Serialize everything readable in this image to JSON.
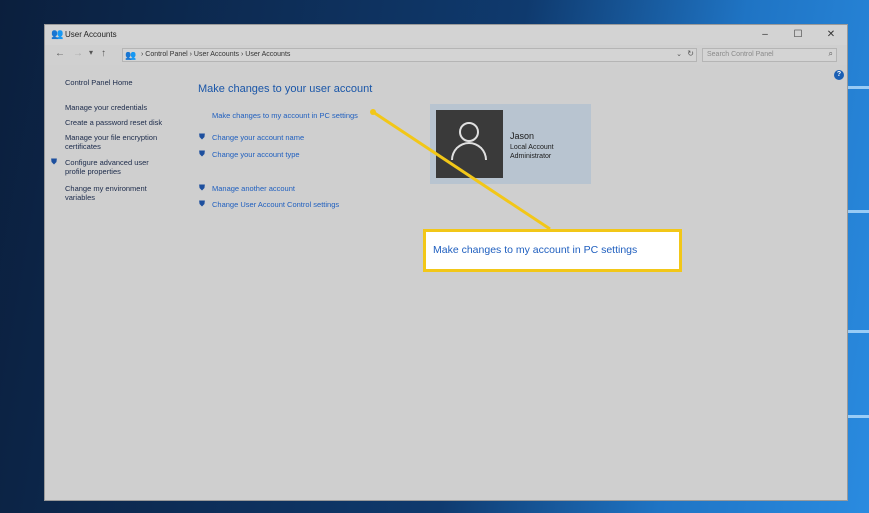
{
  "window": {
    "title": "User Accounts",
    "minimize": "–",
    "maximize": "☐",
    "close": "✕"
  },
  "address": {
    "back": "←",
    "forward": "→",
    "recent": "▾",
    "up": "↑",
    "breadcrumb": "›  Control Panel  ›  User Accounts  ›  User Accounts",
    "dropdown": "⌄",
    "refresh": "↻"
  },
  "search": {
    "placeholder": "Search Control Panel"
  },
  "help": "?",
  "left_panel": {
    "home": "Control Panel Home",
    "items": [
      "Manage your credentials",
      "Create a password reset disk",
      "Manage your file encryption certificates",
      "Configure advanced user profile properties",
      "Change my environment variables"
    ]
  },
  "main": {
    "heading": "Make changes to your user account",
    "pc_settings_link": "Make changes to my account in PC settings",
    "change_name": "Change your account name",
    "change_type": "Change your account type",
    "manage_another": "Manage another account",
    "uac_settings": "Change User Account Control settings"
  },
  "account": {
    "name": "Jason",
    "type": "Local Account",
    "role": "Administrator"
  },
  "callout": {
    "text": "Make changes to my account in PC settings"
  },
  "colors": {
    "accent": "#f2c718",
    "link": "#1f5fbf"
  }
}
